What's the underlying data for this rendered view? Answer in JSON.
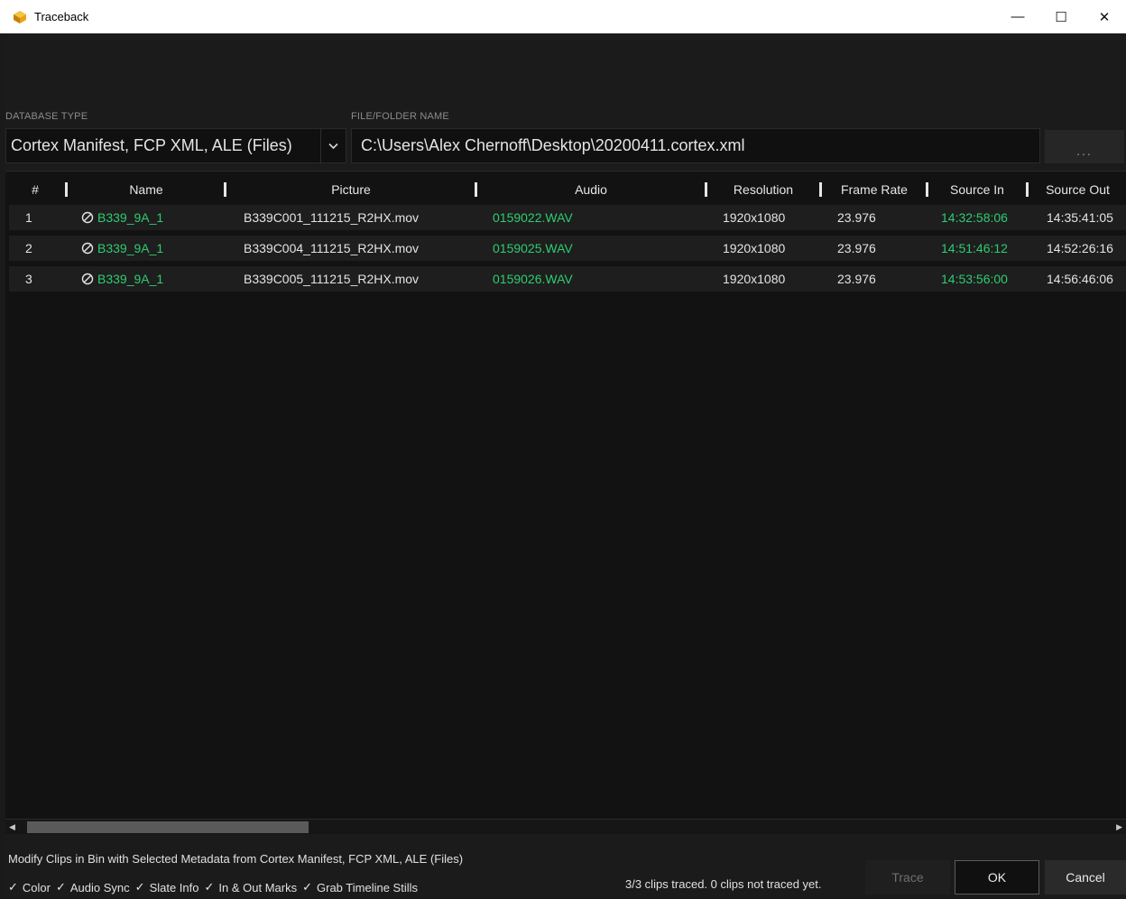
{
  "window": {
    "title": "Traceback",
    "minimize": "—",
    "maximize": "☐",
    "close": "✕"
  },
  "labels": {
    "database_type": "DATABASE TYPE",
    "file_folder_name": "FILE/FOLDER NAME"
  },
  "database_type": {
    "selected": "Cortex Manifest, FCP XML, ALE (Files)",
    "arrow": "⌄"
  },
  "file_path": {
    "value": "C:\\Users\\Alex Chernoff\\Desktop\\20200411.cortex.xml"
  },
  "browse_button": {
    "label": "..."
  },
  "table": {
    "columns": [
      "#",
      "Name",
      "Picture",
      "Audio",
      "Resolution",
      "Frame Rate",
      "Source In",
      "Source Out"
    ],
    "rows": [
      {
        "num": "1",
        "name": "B339_9A_1",
        "picture": "B339C001_111215_R2HX.mov",
        "audio": "0159022.WAV",
        "resolution": "1920x1080",
        "frame_rate": "23.976",
        "source_in": "14:32:58:06",
        "source_out": "14:35:41:05"
      },
      {
        "num": "2",
        "name": "B339_9A_1",
        "picture": "B339C004_111215_R2HX.mov",
        "audio": "0159025.WAV",
        "resolution": "1920x1080",
        "frame_rate": "23.976",
        "source_in": "14:51:46:12",
        "source_out": "14:52:26:16"
      },
      {
        "num": "3",
        "name": "B339_9A_1",
        "picture": "B339C005_111215_R2HX.mov",
        "audio": "0159026.WAV",
        "resolution": "1920x1080",
        "frame_rate": "23.976",
        "source_in": "14:53:56:00",
        "source_out": "14:56:46:06"
      }
    ]
  },
  "footer": {
    "modify_text": "Modify Clips in Bin with Selected Metadata from Cortex Manifest, FCP XML, ALE (Files)",
    "checkboxes": [
      {
        "label": "Color",
        "checked": true
      },
      {
        "label": "Audio Sync",
        "checked": true
      },
      {
        "label": "Slate Info",
        "checked": true
      },
      {
        "label": "In & Out Marks",
        "checked": true
      },
      {
        "label": "Grab Timeline Stills",
        "checked": true
      }
    ],
    "check_mark": "✓",
    "status": "3/3 clips traced. 0 clips not traced yet.",
    "trace_button": "Trace",
    "ok_button": "OK",
    "cancel_button": "Cancel"
  },
  "colors": {
    "accent_green": "#2ecc71",
    "background": "#1b1b1b"
  }
}
